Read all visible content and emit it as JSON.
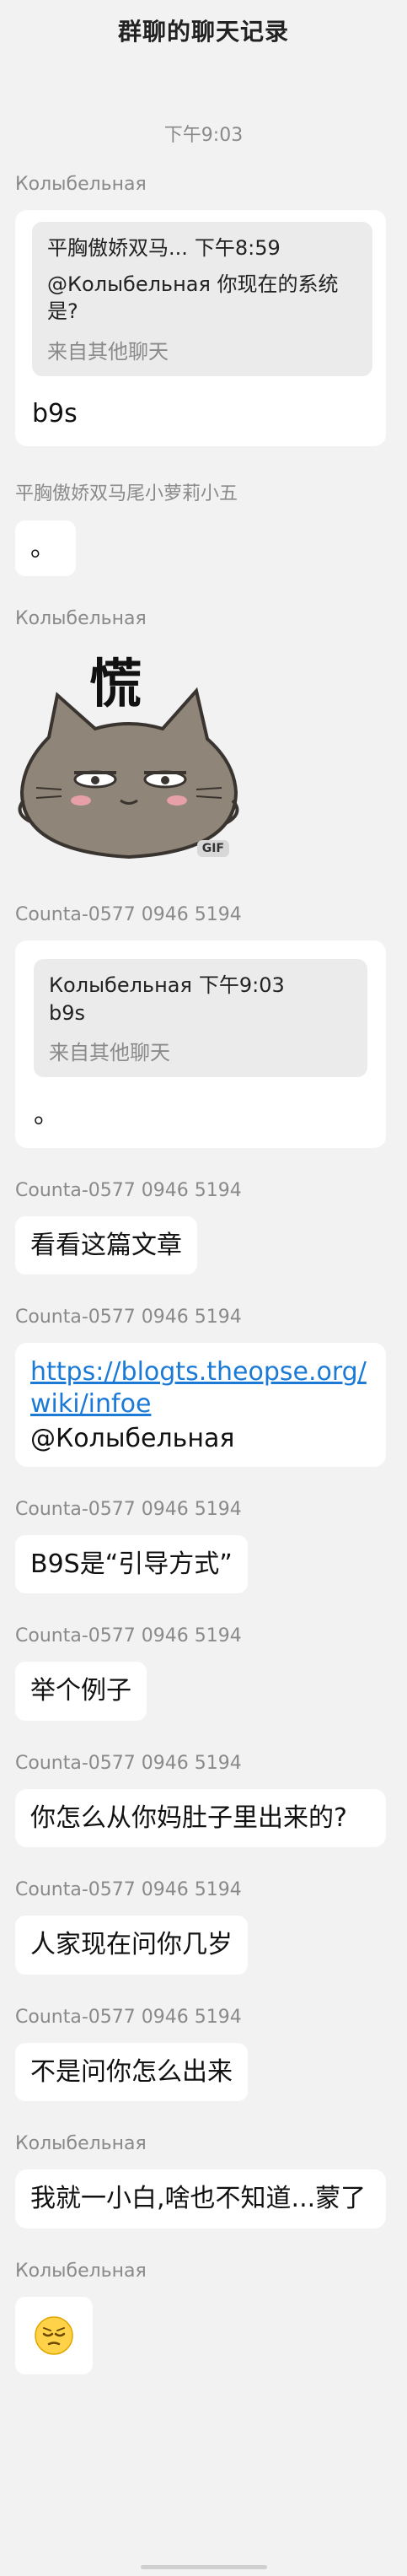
{
  "header": {
    "title": "群聊的聊天记录"
  },
  "timestamp": "下午9:03",
  "messages": [
    {
      "sender": "Колыбельная",
      "quote": {
        "author": "平胸傲娇双马...",
        "time": "下午8:59",
        "text": "@Колыбельная 你现在的系统是?",
        "source": "来自其他聊天"
      },
      "text": "b9s"
    },
    {
      "sender": "平胸傲娇双马尾小萝莉小五",
      "text": "。"
    },
    {
      "sender": "Колыбельная",
      "sticker": {
        "caption": "慌",
        "badge": "GIF"
      }
    },
    {
      "sender": "Counta-0577 0946 5194",
      "quote": {
        "author": "Колыбельная",
        "time": "下午9:03",
        "text": "b9s",
        "source": "来自其他聊天"
      },
      "text": "。"
    },
    {
      "sender": "Counta-0577 0946 5194",
      "text": "看看这篇文章"
    },
    {
      "sender": "Counta-0577 0946 5194",
      "link": "https://blogts.theopse.org/wiki/infoe",
      "mention": "@Колыбельная"
    },
    {
      "sender": "Counta-0577 0946 5194",
      "text": "B9S是“引导方式”"
    },
    {
      "sender": "Counta-0577 0946 5194",
      "text": "举个例子"
    },
    {
      "sender": "Counta-0577 0946 5194",
      "text": "你怎么从你妈肚子里出来的?"
    },
    {
      "sender": "Counta-0577 0946 5194",
      "text": "人家现在问你几岁"
    },
    {
      "sender": "Counta-0577 0946 5194",
      "text": "不是问你怎么出来"
    },
    {
      "sender": "Колыбельная",
      "text": "我就一小白,啥也不知道...蒙了"
    },
    {
      "sender": "Колыбельная",
      "emoji": "pensive-face"
    }
  ]
}
